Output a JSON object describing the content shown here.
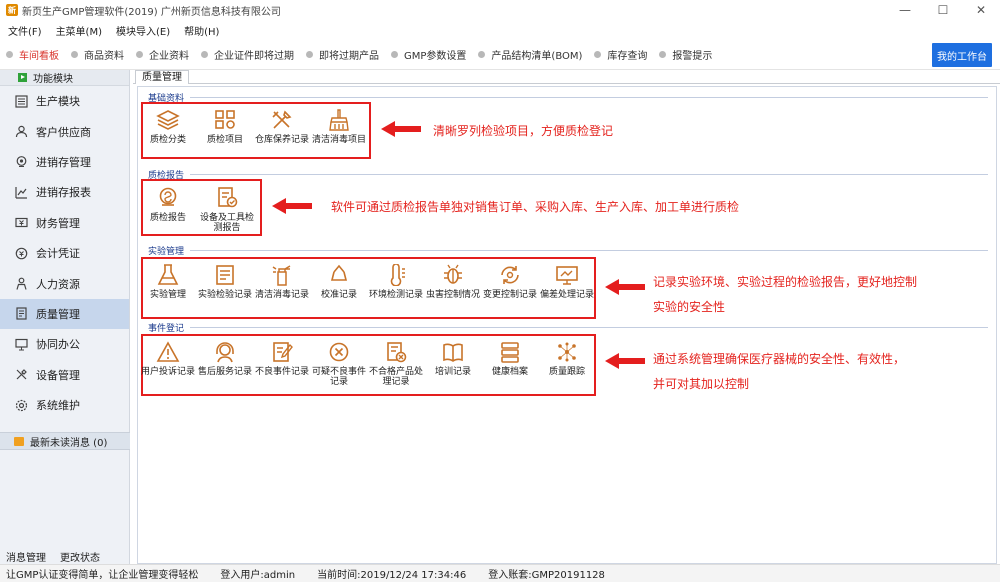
{
  "window": {
    "title": "新页生产GMP管理软件(2019) 广州新页信息科技有限公司",
    "controls": [
      "—",
      "☐",
      "✕"
    ]
  },
  "menu": [
    "文件(F)",
    "主菜单(M)",
    "模块导入(E)",
    "帮助(H)"
  ],
  "quickbar": {
    "items": [
      "车间看板",
      "商品资料",
      "企业资料",
      "企业证件即将过期",
      "即将过期产品",
      "GMP参数设置",
      "产品结构清单(BOM)",
      "库存查询",
      "报警提示"
    ],
    "workbench": "我的工作台"
  },
  "sidebar": {
    "header": "功能模块",
    "items": [
      "生产模块",
      "客户供应商",
      "进销存管理",
      "进销存报表",
      "财务管理",
      "会计凭证",
      "人力资源",
      "质量管理",
      "协同办公",
      "设备管理",
      "系统维护"
    ],
    "messages": "最新未读消息 (0)",
    "bottom": [
      "消息管理",
      "更改状态"
    ]
  },
  "tab": "质量管理",
  "sections": [
    {
      "title": "基础资料",
      "items": [
        "质检分类",
        "质检项目",
        "仓库保养记录",
        "清洁消毒项目"
      ]
    },
    {
      "title": "质检报告",
      "items": [
        "质检报告",
        "设备及工具检测报告"
      ]
    },
    {
      "title": "实验管理",
      "items": [
        "实验管理",
        "实验检验记录",
        "清洁消毒记录",
        "校准记录",
        "环境检测记录",
        "虫害控制情况",
        "变更控制记录",
        "偏差处理记录"
      ]
    },
    {
      "title": "事件登记",
      "items": [
        "用户投诉记录",
        "售后服务记录",
        "不良事件记录",
        "可疑不良事件记录",
        "不合格产品处理记录",
        "培训记录",
        "健康档案",
        "质量跟踪"
      ]
    }
  ],
  "annotations": {
    "a1": "清晰罗列检验项目，方便质检登记",
    "a2": "软件可通过质检报告单独对销售订单、采购入库、生产入库、加工单进行质检",
    "a3_l1": "记录实验环境、实验过程的检验报告，更好地控制",
    "a3_l2": "实验的安全性",
    "a4_l1": "通过系统管理确保医疗器械的安全性、有效性，",
    "a4_l2": "并可对其加以控制"
  },
  "status": {
    "slogan": "让GMP认证变得简单，让企业管理变得轻松",
    "user": "登入用户:admin",
    "time": "当前时间:2019/12/24 17:34:46",
    "account": "登入账套:GMP20191128"
  },
  "colors": {
    "accent": "#e41e1e",
    "icon": "#c8742a",
    "blue": "#1e6fe0"
  }
}
